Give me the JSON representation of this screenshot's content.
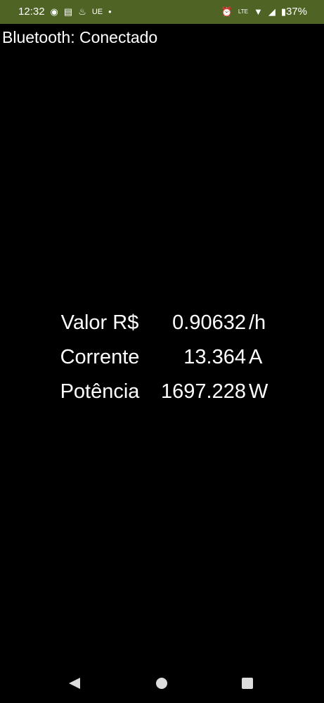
{
  "status_bar": {
    "time": "12:32",
    "carrier": "UE",
    "battery": "37%",
    "color": "#4f6424",
    "icons": [
      "whatsapp-icon",
      "news-icon",
      "app-icon",
      "dot-icon",
      "alarm-icon",
      "volte-icon",
      "wifi-icon",
      "signal-icon",
      "battery-icon"
    ]
  },
  "bluetooth_status": "Bluetooth: Conectado",
  "readings": [
    {
      "label": "Valor R$",
      "value": "0.90632",
      "unit": "/h"
    },
    {
      "label": "Corrente",
      "value": "13.364",
      "unit": "A"
    },
    {
      "label": "Potência",
      "value": "1697.228",
      "unit": "W"
    }
  ]
}
